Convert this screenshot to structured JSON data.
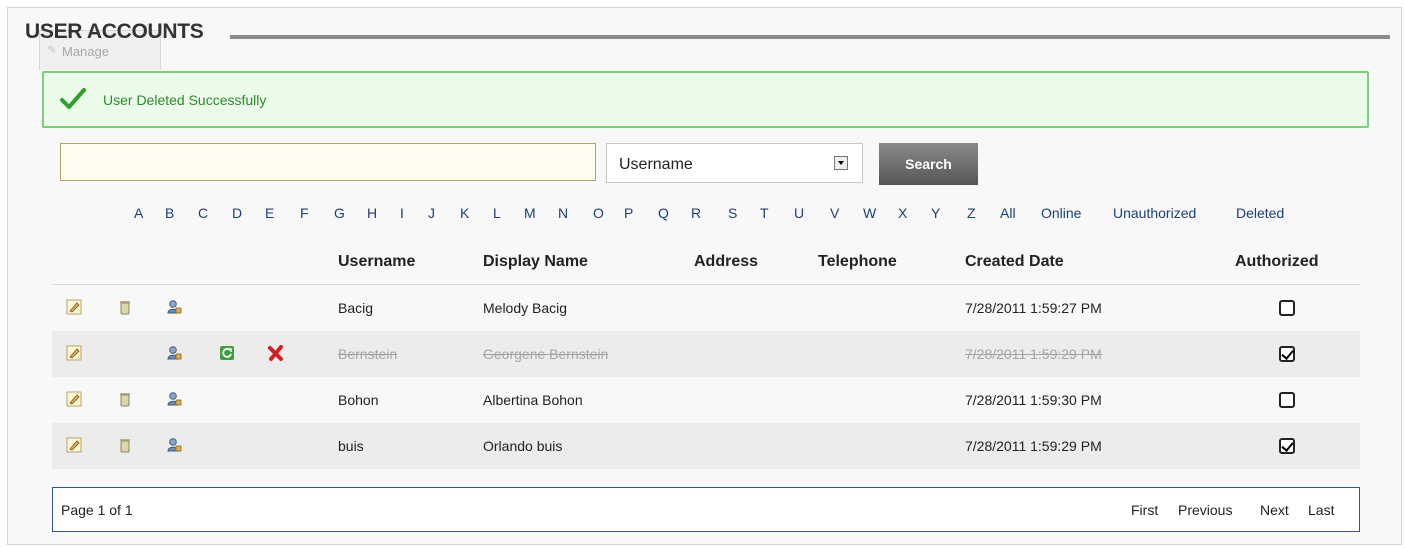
{
  "manage_tab_label": "Manage",
  "page_title": "USER ACCOUNTS",
  "alert_message": "User Deleted Successfully",
  "search": {
    "value": "",
    "filter_selected": "Username",
    "button_label": "Search"
  },
  "letter_filters": [
    "A",
    "B",
    "C",
    "D",
    "E",
    "F",
    "G",
    "H",
    "I",
    "J",
    "K",
    "L",
    "M",
    "N",
    "O",
    "P",
    "Q",
    "R",
    "S",
    "T",
    "U",
    "V",
    "W",
    "X",
    "Y",
    "Z",
    "All",
    "Online",
    "Unauthorized",
    "Deleted"
  ],
  "columns": {
    "username": "Username",
    "display_name": "Display Name",
    "address": "Address",
    "telephone": "Telephone",
    "created_date": "Created Date",
    "authorized": "Authorized"
  },
  "rows": [
    {
      "username": "Bacig",
      "display_name": "Melody Bacig",
      "address": "",
      "telephone": "",
      "created_date": "7/28/2011 1:59:27 PM",
      "authorized": false,
      "deleted": false
    },
    {
      "username": "Bernstein",
      "display_name": "Georgene Bernstein",
      "address": "",
      "telephone": "",
      "created_date": "7/28/2011 1:59:29 PM",
      "authorized": true,
      "deleted": true
    },
    {
      "username": "Bohon",
      "display_name": "Albertina Bohon",
      "address": "",
      "telephone": "",
      "created_date": "7/28/2011 1:59:30 PM",
      "authorized": false,
      "deleted": false
    },
    {
      "username": "buis",
      "display_name": "Orlando buis",
      "address": "",
      "telephone": "",
      "created_date": "7/28/2011 1:59:29 PM",
      "authorized": true,
      "deleted": false
    }
  ],
  "pager": {
    "status": "Page 1 of 1",
    "first": "First",
    "previous": "Previous",
    "next": "Next",
    "last": "Last"
  },
  "colors": {
    "alert_bg": "#eafbea",
    "alert_border": "#7ccd7c",
    "alert_text": "#2d8a2d",
    "link": "#1c3f7a",
    "footer_border": "#2f5597"
  }
}
